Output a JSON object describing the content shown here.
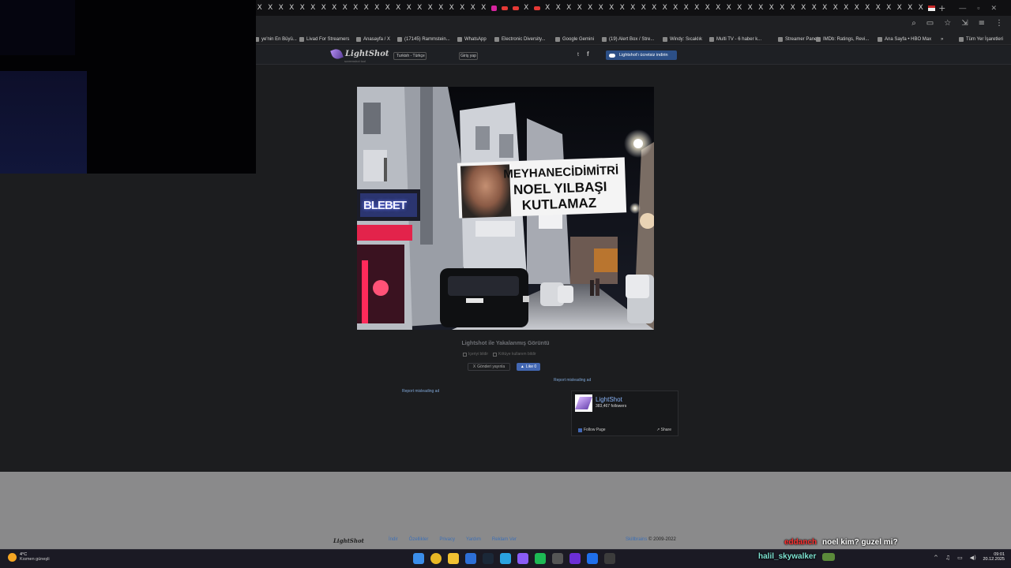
{
  "browser": {
    "tab_close_glyph": "X",
    "new_tab": "+",
    "window_controls": [
      "—",
      "▫",
      "✕"
    ],
    "toolbar_icons": [
      "⌕",
      "▭",
      "☆",
      "⇲",
      "≡",
      "⋮"
    ],
    "bookmarks": [
      {
        "label": "ye'nin En Büyü...",
        "icon": "globe-icon"
      },
      {
        "label": "Livad For Streamers",
        "icon": "livad-icon"
      },
      {
        "label": "Anasayfa / X",
        "icon": "x-icon"
      },
      {
        "label": "(17145) Rammstein...",
        "icon": "youtube-icon"
      },
      {
        "label": "WhatsApp",
        "icon": "whatsapp-icon"
      },
      {
        "label": "Electronic Diversity...",
        "icon": "doc-icon"
      },
      {
        "label": "Google Gemini",
        "icon": "gemini-icon"
      },
      {
        "label": "(19) Alert Box / Stre...",
        "icon": "streamlabs-icon"
      },
      {
        "label": "Windy: Sıcaklık",
        "icon": "windy-icon"
      },
      {
        "label": "Multi TV - 6 haber k...",
        "icon": "tv-icon"
      },
      {
        "label": "Streamer Panel",
        "icon": "panel-icon"
      },
      {
        "label": "IMDb: Ratings, Revi...",
        "icon": "imdb-icon"
      },
      {
        "label": "Ana Sayfa • HBO Max",
        "icon": "hbo-icon"
      },
      {
        "label": "»",
        "icon": ""
      },
      {
        "label": "Tüm Yer İşaretleri",
        "icon": "folder-icon"
      }
    ]
  },
  "lightshot": {
    "logo_text": "LightShot",
    "logo_tagline": "screenshot tool",
    "language": "Turkish - Türkçe",
    "login": "Giriş yap",
    "twitter_glyph": "t",
    "facebook_glyph": "f",
    "download_button": "Lightshot'ı ücretsiz indirin"
  },
  "screenshot": {
    "banner_line1": "MEYHANECİDİMİTRİ",
    "banner_line2": "NOEL YILBAŞI",
    "banner_line3": "KUTLAMAZ",
    "storefront_sign": "BLEBET"
  },
  "below_image": {
    "caption": "Lightshot ile Yakalanmış Görüntü",
    "action_report": "Içeriyi bildir",
    "action_copyright": "Kötüye kullanım bildir",
    "tweet": "Gönderi yayınla",
    "like": "Like 0",
    "report_ad_1": "Report misleading ad",
    "report_ad_2": "Report misleading ad"
  },
  "fb_widget": {
    "page_name": "LightShot",
    "followers": "383,467 followers",
    "follow": "Follow Page",
    "share": "Share"
  },
  "footer": {
    "logo": "LightShot",
    "links": [
      "İndir",
      "Özellikler",
      "Privacy",
      "Yardım",
      "Reklam Ver"
    ],
    "copyright_link": "Skillbrains",
    "copyright_text": "© 2009-2022"
  },
  "chat": {
    "message1_user": "eddanch",
    "message1_text": "noel kim? guzel mi?",
    "message2_user": "halil_skywalker"
  },
  "taskbar": {
    "temperature": "4°C",
    "condition": "Kısmen güneşli",
    "time": "09:01",
    "date": "20.12.2025",
    "tray_icons": [
      "^",
      "♫",
      "▭",
      "◀)"
    ],
    "icons": [
      {
        "name": "windows-start-icon",
        "color": "#3b8eea"
      },
      {
        "name": "chrome-icon",
        "color": "#e8b825"
      },
      {
        "name": "file-explorer-icon",
        "color": "#f1c232"
      },
      {
        "name": "app-icon-blue",
        "color": "#2d6fd6"
      },
      {
        "name": "steam-icon",
        "color": "#1b2838"
      },
      {
        "name": "telegram-icon",
        "color": "#2aa3e0"
      },
      {
        "name": "app-icon-purple",
        "color": "#8a5cf6"
      },
      {
        "name": "spotify-icon",
        "color": "#1db954"
      },
      {
        "name": "calculator-icon",
        "color": "#555"
      },
      {
        "name": "kick-icon",
        "color": "#6b2fd6"
      },
      {
        "name": "app-icon-blue2",
        "color": "#1f6feb"
      },
      {
        "name": "obs-icon",
        "color": "#3c3c3c"
      }
    ]
  }
}
